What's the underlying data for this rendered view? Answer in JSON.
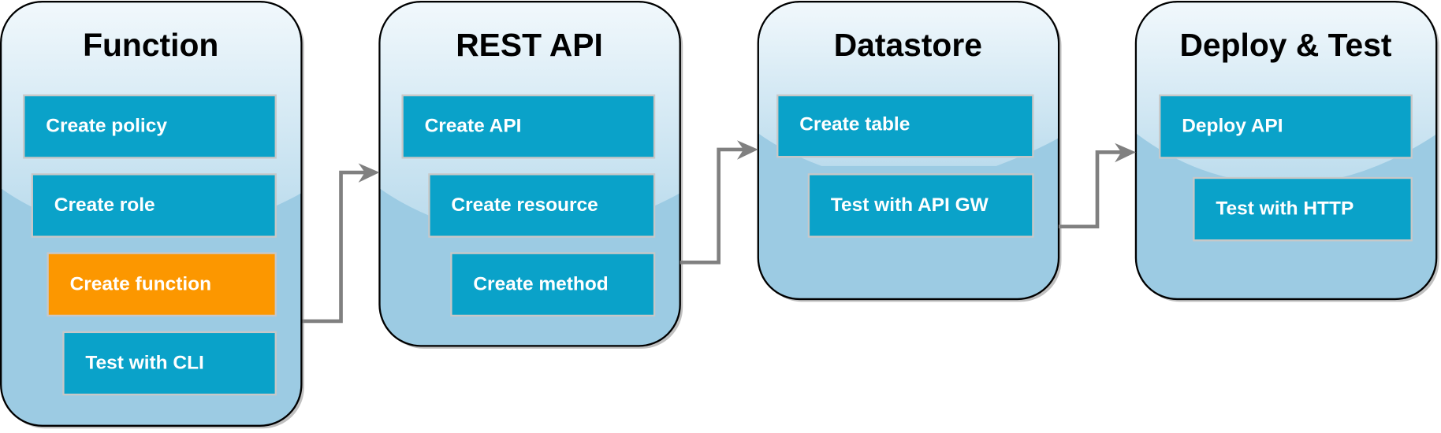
{
  "colors": {
    "step": "#0aa2c9",
    "current_step": "#fc9700",
    "stage_bottom": "#9ccbe3",
    "stage_top": "#eef6fb",
    "connector": "#808080"
  },
  "stages": [
    {
      "title": "Function",
      "steps": [
        "Create policy",
        "Create role",
        "Create function",
        "Test with CLI"
      ],
      "current_step": "Create function"
    },
    {
      "title": "REST API",
      "steps": [
        "Create API",
        "Create resource",
        "Create method"
      ]
    },
    {
      "title": "Datastore",
      "steps": [
        "Create table",
        "Test with API GW"
      ]
    },
    {
      "title": "Deploy & Test",
      "steps": [
        "Deploy API",
        "Test with HTTP"
      ]
    }
  ]
}
